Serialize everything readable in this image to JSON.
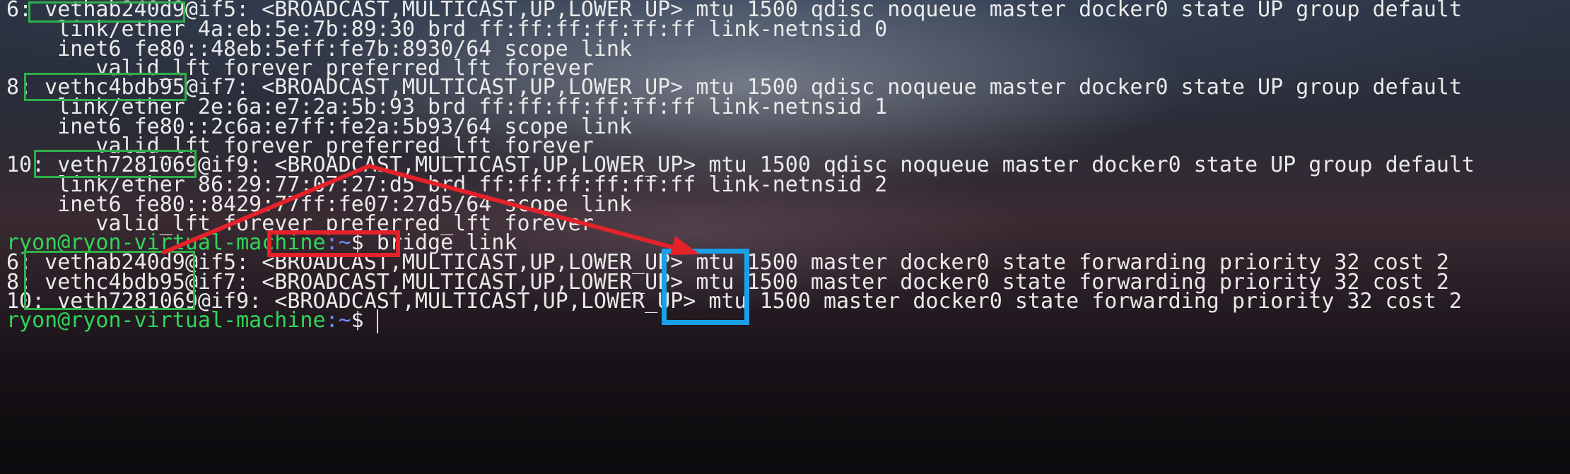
{
  "terminal": {
    "lines": [
      "6: vethab240d9@if5: <BROADCAST,MULTICAST,UP,LOWER_UP> mtu 1500 qdisc noqueue master docker0 state UP group default",
      "    link/ether 4a:eb:5e:7b:89:30 brd ff:ff:ff:ff:ff:ff link-netnsid 0",
      "    inet6 fe80::48eb:5eff:fe7b:8930/64 scope link",
      "       valid_lft forever preferred_lft forever",
      "8: vethc4bdb95@if7: <BROADCAST,MULTICAST,UP,LOWER_UP> mtu 1500 qdisc noqueue master docker0 state UP group default",
      "    link/ether 2e:6a:e7:2a:5b:93 brd ff:ff:ff:ff:ff:ff link-netnsid 1",
      "    inet6 fe80::2c6a:e7ff:fe2a:5b93/64 scope link",
      "       valid_lft forever preferred_lft forever",
      "10: veth7281069@if9: <BROADCAST,MULTICAST,UP,LOWER_UP> mtu 1500 qdisc noqueue master docker0 state UP group default",
      "    link/ether 86:29:77:07:27:d5 brd ff:ff:ff:ff:ff:ff link-netnsid 2",
      "    inet6 fe80::8429:77ff:fe07:27d5/64 scope link",
      "       valid_lft forever preferred_lft forever"
    ],
    "prompt1": {
      "user_host": "ryon@ryon-virtual-machine",
      "path": ":~",
      "sign": "$",
      "command": " bridge link"
    },
    "bridge_lines": [
      "6: vethab240d9@if5: <BROADCAST,MULTICAST,UP,LOWER_UP> mtu 1500 master docker0 state forwarding priority 32 cost 2",
      "8: vethc4bdb95@if7: <BROADCAST,MULTICAST,UP,LOWER_UP> mtu 1500 master docker0 state forwarding priority 32 cost 2",
      "10: veth7281069@if9: <BROADCAST,MULTICAST,UP,LOWER_UP> mtu 1500 master docker0 state forwarding priority 32 cost 2"
    ],
    "prompt2": {
      "user_host": "ryon@ryon-virtual-machine",
      "path": ":~",
      "sign": "$"
    }
  },
  "annotations": {
    "green": "#2fb04a",
    "red": "#e5212a",
    "blue": "#1aa0e8"
  }
}
